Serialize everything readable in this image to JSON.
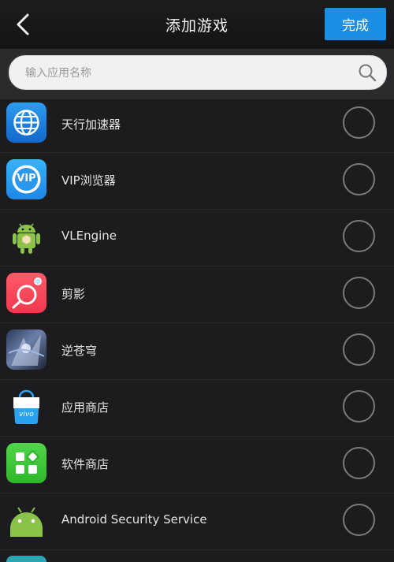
{
  "header": {
    "title": "添加游戏",
    "done_label": "完成"
  },
  "search": {
    "placeholder": "输入应用名称"
  },
  "apps": [
    {
      "name": "天行加速器",
      "icon": "globe-icon"
    },
    {
      "name": "VIP浏览器",
      "icon": "vip-browser-icon",
      "icon_text": "VIP"
    },
    {
      "name": "VLEngine",
      "icon": "android-robot-icon"
    },
    {
      "name": "剪影",
      "icon": "jianying-icon"
    },
    {
      "name": "逆苍穹",
      "icon": "game-art-icon"
    },
    {
      "name": "应用商店",
      "icon": "vivo-store-icon",
      "icon_text": "vivo"
    },
    {
      "name": "软件商店",
      "icon": "software-store-icon"
    },
    {
      "name": "Android Security Service",
      "icon": "android-head-icon"
    }
  ],
  "colors": {
    "accent": "#1b8fe3",
    "background": "#1c1c1e"
  }
}
